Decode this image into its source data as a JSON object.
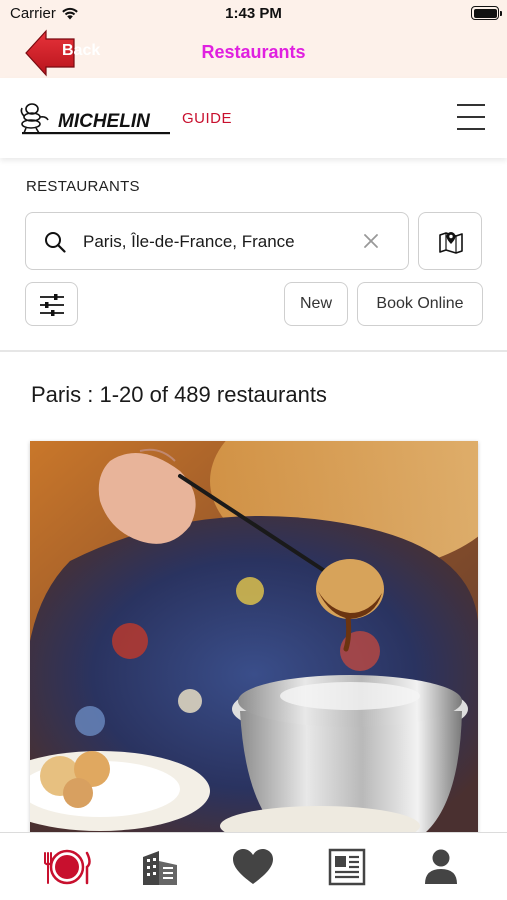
{
  "status_bar": {
    "carrier": "Carrier",
    "time": "1:43 PM"
  },
  "nav": {
    "back_label": "Back",
    "title": "Restaurants"
  },
  "brand": {
    "logo_text": "MICHELIN",
    "guide_label": "GUIDE"
  },
  "search": {
    "section_label": "RESTAURANTS",
    "value": "Paris, Île-de-France, France",
    "filter_chips": [
      "New",
      "Book Online"
    ]
  },
  "results": {
    "count_text": "Paris : 1-20 of 489 restaurants"
  },
  "tab_bar": {
    "items": [
      "restaurants-tab-icon",
      "hotels-tab-icon",
      "favorites-tab-icon",
      "articles-tab-icon",
      "profile-tab-icon"
    ],
    "active_index": 0
  },
  "colors": {
    "nav_background": "#fdf1ea",
    "title_color": "#e020e0",
    "michelin_red": "#c8102e",
    "tab_inactive": "#444444"
  }
}
